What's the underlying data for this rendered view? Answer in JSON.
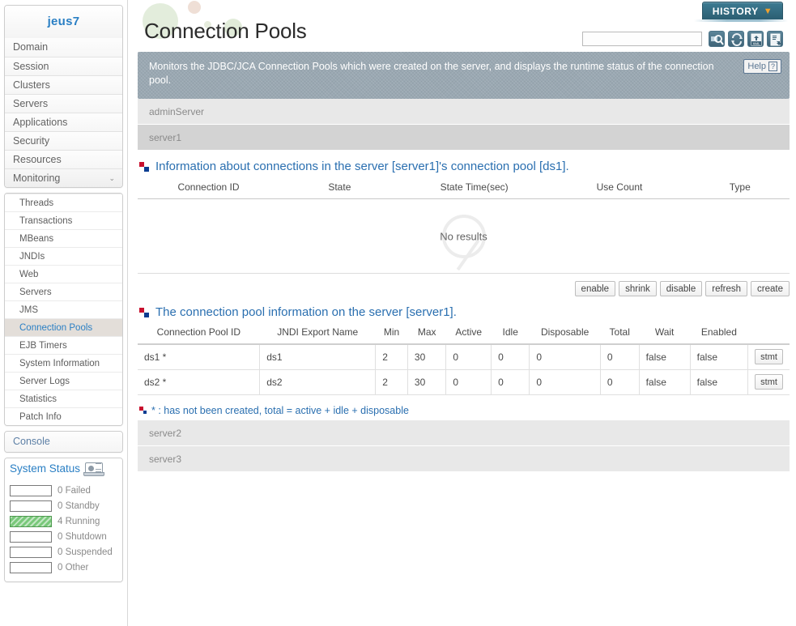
{
  "sidebar": {
    "brand": "jeus7",
    "nav": [
      {
        "label": "Domain",
        "expandable": false
      },
      {
        "label": "Session",
        "expandable": false
      },
      {
        "label": "Clusters",
        "expandable": false
      },
      {
        "label": "Servers",
        "expandable": false
      },
      {
        "label": "Applications",
        "expandable": false
      },
      {
        "label": "Security",
        "expandable": false
      },
      {
        "label": "Resources",
        "expandable": false
      },
      {
        "label": "Monitoring",
        "expandable": true,
        "caret": "⌄"
      }
    ],
    "submenu": [
      {
        "label": "Threads",
        "active": false
      },
      {
        "label": "Transactions",
        "active": false
      },
      {
        "label": "MBeans",
        "active": false
      },
      {
        "label": "JNDIs",
        "active": false
      },
      {
        "label": "Web",
        "active": false
      },
      {
        "label": "Servers",
        "active": false
      },
      {
        "label": "JMS",
        "active": false
      },
      {
        "label": "Connection Pools",
        "active": true
      },
      {
        "label": "EJB Timers",
        "active": false
      },
      {
        "label": "System Information",
        "active": false
      },
      {
        "label": "Server Logs",
        "active": false
      },
      {
        "label": "Statistics",
        "active": false
      },
      {
        "label": "Patch Info",
        "active": false
      }
    ],
    "console_label": "Console",
    "system_status": {
      "title": "System Status",
      "icon": "laptop-icon",
      "rows": [
        {
          "count": "0",
          "label": "Failed",
          "filled": false
        },
        {
          "count": "0",
          "label": "Standby",
          "filled": false
        },
        {
          "count": "4",
          "label": "Running",
          "filled": true
        },
        {
          "count": "0",
          "label": "Shutdown",
          "filled": false
        },
        {
          "count": "0",
          "label": "Suspended",
          "filled": false
        },
        {
          "count": "0",
          "label": "Other",
          "filled": false
        }
      ],
      "fill_color": "#79c87a"
    }
  },
  "header": {
    "page_title": "Connection Pools",
    "history_label": "HISTORY",
    "history_caret": "▼",
    "search_value": "",
    "search_placeholder": "",
    "toolbar_icons": [
      "search-icon",
      "refresh-icon",
      "xml-export-icon",
      "report-export-icon"
    ]
  },
  "banner": {
    "text": "Monitors the JDBC/JCA Connection Pools which were created on the server, and displays the runtime status of the connection pool.",
    "help_label": "Help",
    "help_mark": "?"
  },
  "servers_top": [
    {
      "name": "adminServer",
      "selected": false
    },
    {
      "name": "server1",
      "selected": true
    }
  ],
  "servers_bottom": [
    {
      "name": "server2",
      "selected": false
    },
    {
      "name": "server3",
      "selected": false
    }
  ],
  "connections_section": {
    "title": "Information about connections in the server [server1]'s connection pool [ds1].",
    "columns": [
      "Connection ID",
      "State",
      "State Time(sec)",
      "Use Count",
      "Type"
    ],
    "empty_text": "No results",
    "rows": []
  },
  "actions": [
    {
      "label": "enable"
    },
    {
      "label": "shrink"
    },
    {
      "label": "disable"
    },
    {
      "label": "refresh"
    },
    {
      "label": "create"
    }
  ],
  "pool_section": {
    "title": "The connection pool information on the server [server1].",
    "columns": [
      "Connection Pool ID",
      "JNDI Export Name",
      "Min",
      "Max",
      "Active",
      "Idle",
      "Disposable",
      "Total",
      "Wait",
      "Enabled",
      ""
    ],
    "rows": [
      {
        "pool_id": "ds1 *",
        "jndi": "ds1",
        "min": "2",
        "max": "30",
        "active": "0",
        "idle": "0",
        "disposable": "0",
        "total": "0",
        "wait": "false",
        "enabled": "false",
        "action": "stmt"
      },
      {
        "pool_id": "ds2 *",
        "jndi": "ds2",
        "min": "2",
        "max": "30",
        "active": "0",
        "idle": "0",
        "disposable": "0",
        "total": "0",
        "wait": "false",
        "enabled": "false",
        "action": "stmt"
      }
    ]
  },
  "footnote": {
    "text": "* : has not been created, total = active + idle + disposable"
  }
}
